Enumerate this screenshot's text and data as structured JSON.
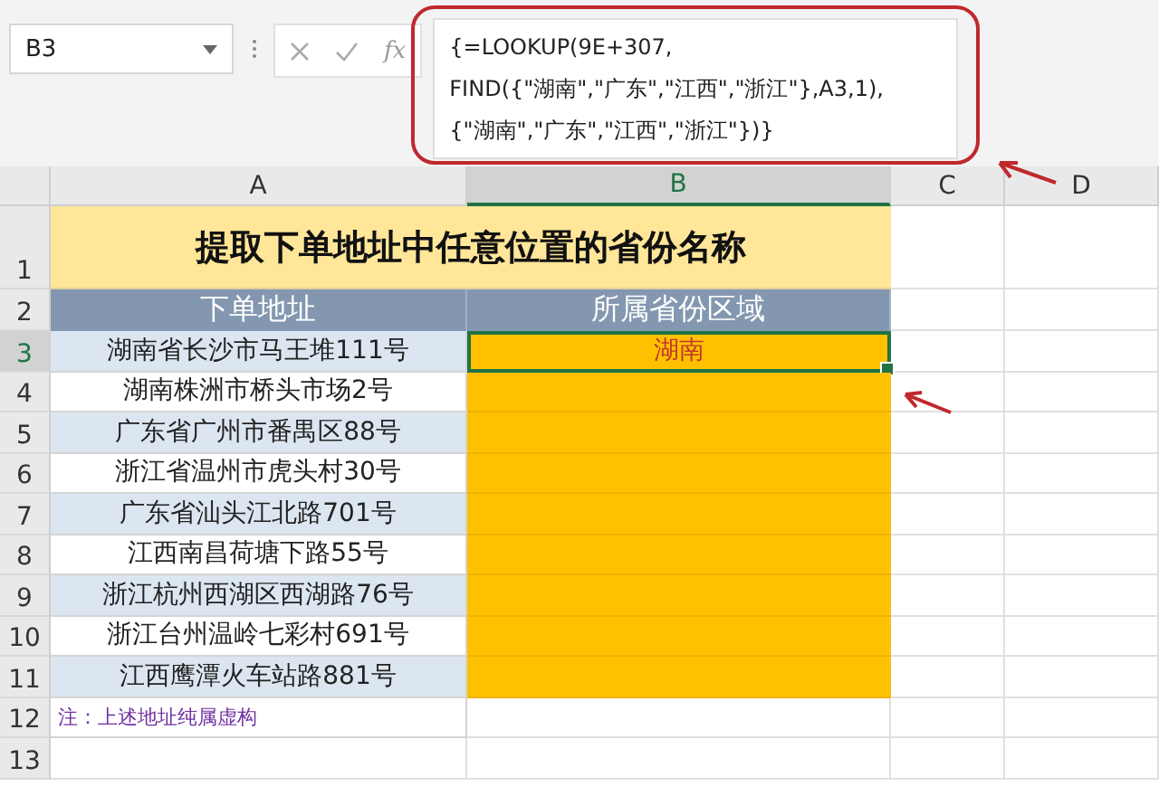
{
  "name_box": {
    "value": "B3"
  },
  "formula_bar": {
    "function_label": "fx",
    "lines": [
      "{=LOOKUP(9E+307,",
      "FIND({\"湖南\",\"广东\",\"江西\",\"浙江\"},A3,1),",
      "{\"湖南\",\"广东\",\"江西\",\"浙江\"})}"
    ]
  },
  "columns": [
    {
      "label": "A",
      "selected": false
    },
    {
      "label": "B",
      "selected": true
    },
    {
      "label": "C",
      "selected": false
    },
    {
      "label": "D",
      "selected": false
    }
  ],
  "row_headers": [
    {
      "label": "1",
      "selected": false
    },
    {
      "label": "2",
      "selected": false
    },
    {
      "label": "3",
      "selected": true
    },
    {
      "label": "4",
      "selected": false
    },
    {
      "label": "5",
      "selected": false
    },
    {
      "label": "6",
      "selected": false
    },
    {
      "label": "7",
      "selected": false
    },
    {
      "label": "8",
      "selected": false
    },
    {
      "label": "9",
      "selected": false
    },
    {
      "label": "10",
      "selected": false
    },
    {
      "label": "11",
      "selected": false
    },
    {
      "label": "12",
      "selected": false
    },
    {
      "label": "13",
      "selected": false
    }
  ],
  "title": "提取下单地址中任意位置的省份名称",
  "header_cells": [
    "下单地址",
    "所属省份区域"
  ],
  "data_rows": [
    {
      "address": "湖南省长沙市马王堆111号",
      "province": "湖南",
      "selected": true
    },
    {
      "address": "湖南株洲市桥头市场2号",
      "selected": false
    },
    {
      "address": "广东省广州市番禺区88号",
      "selected": false
    },
    {
      "address": "浙江省温州市虎头村30号",
      "selected": false
    },
    {
      "address": "广东省汕头江北路701号",
      "selected": false
    },
    {
      "address": "江西南昌荷塘下路55号",
      "selected": false
    },
    {
      "address": "浙江杭州西湖区西湖路76号",
      "selected": false
    },
    {
      "address": "浙江台州温岭七彩村691号",
      "selected": false
    },
    {
      "address": "江西鹰潭火车站路881号",
      "selected": false
    }
  ],
  "note": "注：上述地址纯属虚构"
}
